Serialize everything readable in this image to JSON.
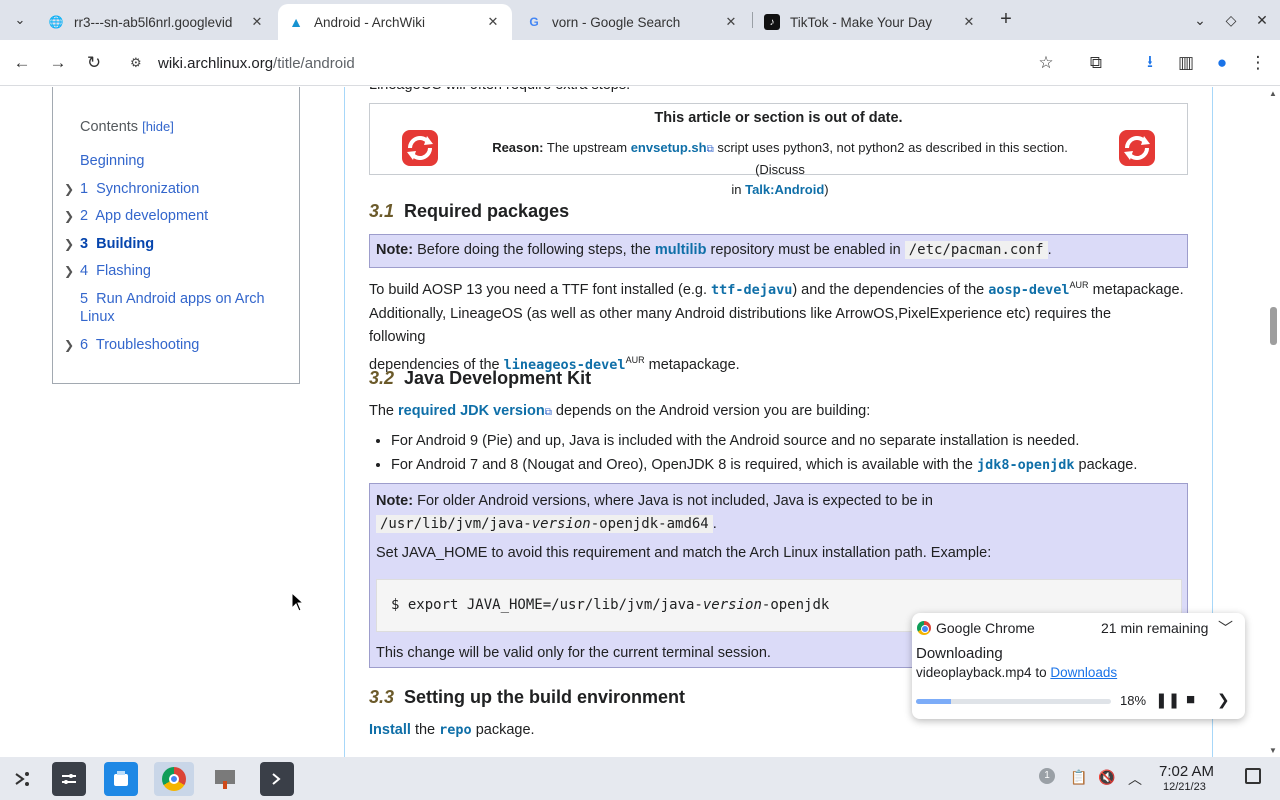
{
  "browser": {
    "tabs": [
      {
        "title": "rr3---sn-ab5l6nrl.googlevid",
        "favicon": "globe-icon"
      },
      {
        "title": "Android - ArchWiki",
        "favicon": "arch-logo-icon"
      },
      {
        "title": "vorn - Google Search",
        "favicon": "google-g-icon"
      },
      {
        "title": "TikTok - Make Your Day",
        "favicon": "tiktok-icon"
      }
    ],
    "active_tab": 1,
    "url_domain": "wiki.archlinux.org",
    "url_path": "/title/android"
  },
  "toc": {
    "heading": "Contents",
    "hide": "[hide]",
    "items": [
      {
        "num": "",
        "label": "Beginning"
      },
      {
        "num": "1",
        "label": "Synchronization"
      },
      {
        "num": "2",
        "label": "App development"
      },
      {
        "num": "3",
        "label": "Building"
      },
      {
        "num": "4",
        "label": "Flashing"
      },
      {
        "num": "5",
        "label": "Run Android apps on Arch"
      },
      {
        "num": "",
        "label": "Linux"
      },
      {
        "num": "6",
        "label": "Troubleshooting"
      }
    ]
  },
  "article": {
    "top_cut": "LineageOS will often require extra steps.",
    "outdated": {
      "title": "This article or section is out of date.",
      "reason_label": "Reason:",
      "reason_pre": "The upstream",
      "reason_link": "envsetup.sh",
      "reason_post": "script uses python3, not python2 as described in this section. (Discuss",
      "reason_in": "in",
      "talk_link": "Talk:Android",
      "close": ")"
    },
    "s31": {
      "num": "3.1",
      "title": "Required packages"
    },
    "note1": {
      "label": "Note:",
      "pre": "Before doing the following steps, the",
      "link": "multilib",
      "post": "repository must be enabled in",
      "code": "/etc/pacman.conf",
      "end": "."
    },
    "p1": {
      "pre": "To build AOSP 13 you need a TTF font installed (e.g.",
      "pkg1": "ttf-dejavu",
      "mid": ") and the dependencies of the",
      "pkg2": "aosp-devel",
      "aur": "AUR",
      "post": "metapackage."
    },
    "p2": {
      "line1": "Additionally, LineageOS (as well as other many Android distributions like ArrowOS,PixelExperience etc) requires the following",
      "pre2": "dependencies of the",
      "pkg": "lineageos-devel",
      "aur": "AUR",
      "post": "metapackage."
    },
    "s32": {
      "num": "3.2",
      "title": "Java Development Kit"
    },
    "p3": {
      "pre": "The",
      "link": "required JDK version",
      "post": "depends on the Android version you are building:"
    },
    "bullets": {
      "b1": "For Android 9 (Pie) and up, Java is included with the Android source and no separate installation is needed.",
      "b2_pre": "For Android 7 and 8 (Nougat and Oreo), OpenJDK 8 is required, which is available with the",
      "b2_pkg": "jdk8-openjdk",
      "b2_post": "package."
    },
    "note2": {
      "label": "Note:",
      "text": "For older Android versions, where Java is not included, Java is expected to be in",
      "code_pre": "/usr/lib/jvm/java-",
      "code_var": "version",
      "code_post": "-openjdk-amd64",
      "end": ".",
      "p2": "Set JAVA_HOME to avoid this requirement and match the Arch Linux installation path. Example:",
      "cmd_pre": "$ export JAVA_HOME=/usr/lib/jvm/java-",
      "cmd_var": "version",
      "cmd_post": "-openjdk",
      "p3": "This change will be valid only for the current terminal session."
    },
    "s33": {
      "num": "3.3",
      "title": "Setting up the build environment"
    },
    "p4": {
      "link": "Install",
      "mid": "the",
      "pkg": "repo",
      "post": "package."
    }
  },
  "download": {
    "app": "Google Chrome",
    "remaining": "21 min remaining",
    "state": "Downloading",
    "file": "videoplayback.mp4 to",
    "folder": "Downloads",
    "percent": "18%",
    "progress": 0.18
  },
  "shelf": {
    "apps": [
      "launcher-icon",
      "settings-icon",
      "files-icon",
      "chrome-icon",
      "image-app-icon",
      "terminal-icon"
    ],
    "notification_count": "1",
    "time": "7:02 AM",
    "date": "12/21/23"
  }
}
